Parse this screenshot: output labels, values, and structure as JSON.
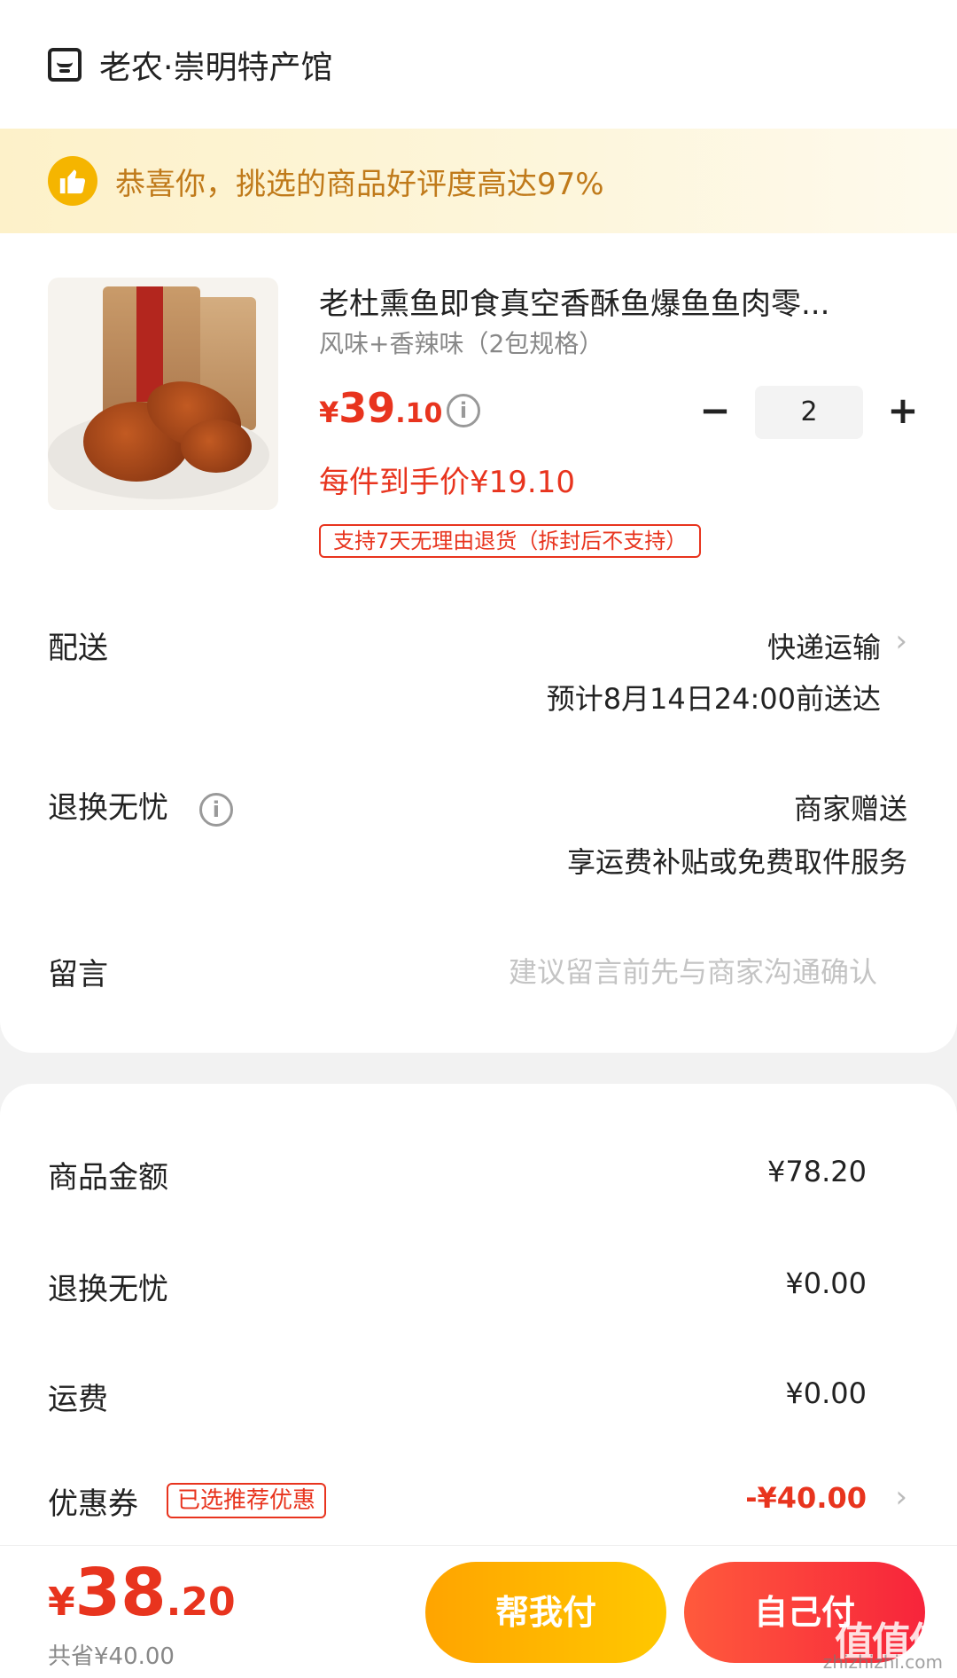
{
  "shop": {
    "name": "老农·崇明特产馆",
    "icon": "store-icon"
  },
  "banner": {
    "text": "恭喜你，挑选的商品好评度高达97%",
    "icon": "thumbs-up-icon"
  },
  "product": {
    "title": "老杜熏鱼即食真空香酥鱼爆鱼鱼肉零...",
    "spec": "风味+香辣味（2包规格）",
    "price_symbol": "¥",
    "price_int": "39",
    "price_dec": ".10",
    "quantity": "2",
    "unit_price": "每件到手价¥19.10",
    "return_tag": "支持7天无理由退货（拆封后不支持）"
  },
  "delivery": {
    "label": "配送",
    "method": "快递运输",
    "eta": "预计8月14日24:00前送达"
  },
  "returns": {
    "label": "退换无忧",
    "value": "商家赠送",
    "desc": "享运费补贴或免费取件服务"
  },
  "message": {
    "label": "留言",
    "placeholder": "建议留言前先与商家沟通确认"
  },
  "summary": {
    "goods_label": "商品金额",
    "goods_value": "¥78.20",
    "returns_label": "退换无忧",
    "returns_value": "¥0.00",
    "shipping_label": "运费",
    "shipping_value": "¥0.00",
    "coupon_label": "优惠券",
    "coupon_tag": "已选推荐优惠",
    "coupon_value": "-¥40.00"
  },
  "bottom": {
    "total_symbol": "¥",
    "total_int": "38",
    "total_dec": ".20",
    "saved": "共省¥40.00",
    "help_pay": "帮我付",
    "self_pay": "自己付"
  },
  "watermark": {
    "text": "值值值",
    "url": "zhizhizhi.com"
  },
  "colors": {
    "accent": "#e8341e",
    "help_btn": "#ffb400",
    "banner_text": "#c07a1a"
  }
}
